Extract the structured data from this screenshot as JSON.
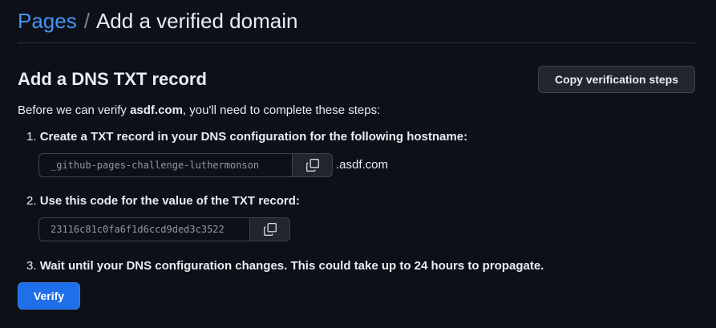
{
  "breadcrumb": {
    "parent": "Pages",
    "separator": "/",
    "title": "Add a verified domain"
  },
  "section": {
    "title": "Add a DNS TXT record",
    "copy_steps_label": "Copy verification steps"
  },
  "intro": {
    "before": "Before we can verify ",
    "domain": "asdf.com",
    "after": ", you'll need to complete these steps:"
  },
  "steps": [
    {
      "number": "1.",
      "text": "Create a TXT record in your DNS configuration for the following hostname:",
      "code": "_github-pages-challenge-luthermonson",
      "suffix": ".asdf.com"
    },
    {
      "number": "2.",
      "text": "Use this code for the value of the TXT record:",
      "code": "23116c81c0fa6f1d6ccd9ded3c3522"
    },
    {
      "number": "3.",
      "text": "Wait until your DNS configuration changes. This could take up to 24 hours to propagate."
    }
  ],
  "verify_label": "Verify",
  "icons": {
    "copy": "copy-icon"
  },
  "colors": {
    "background": "#0d1117",
    "link": "#4493f8",
    "primary_button": "#1f6feb"
  }
}
